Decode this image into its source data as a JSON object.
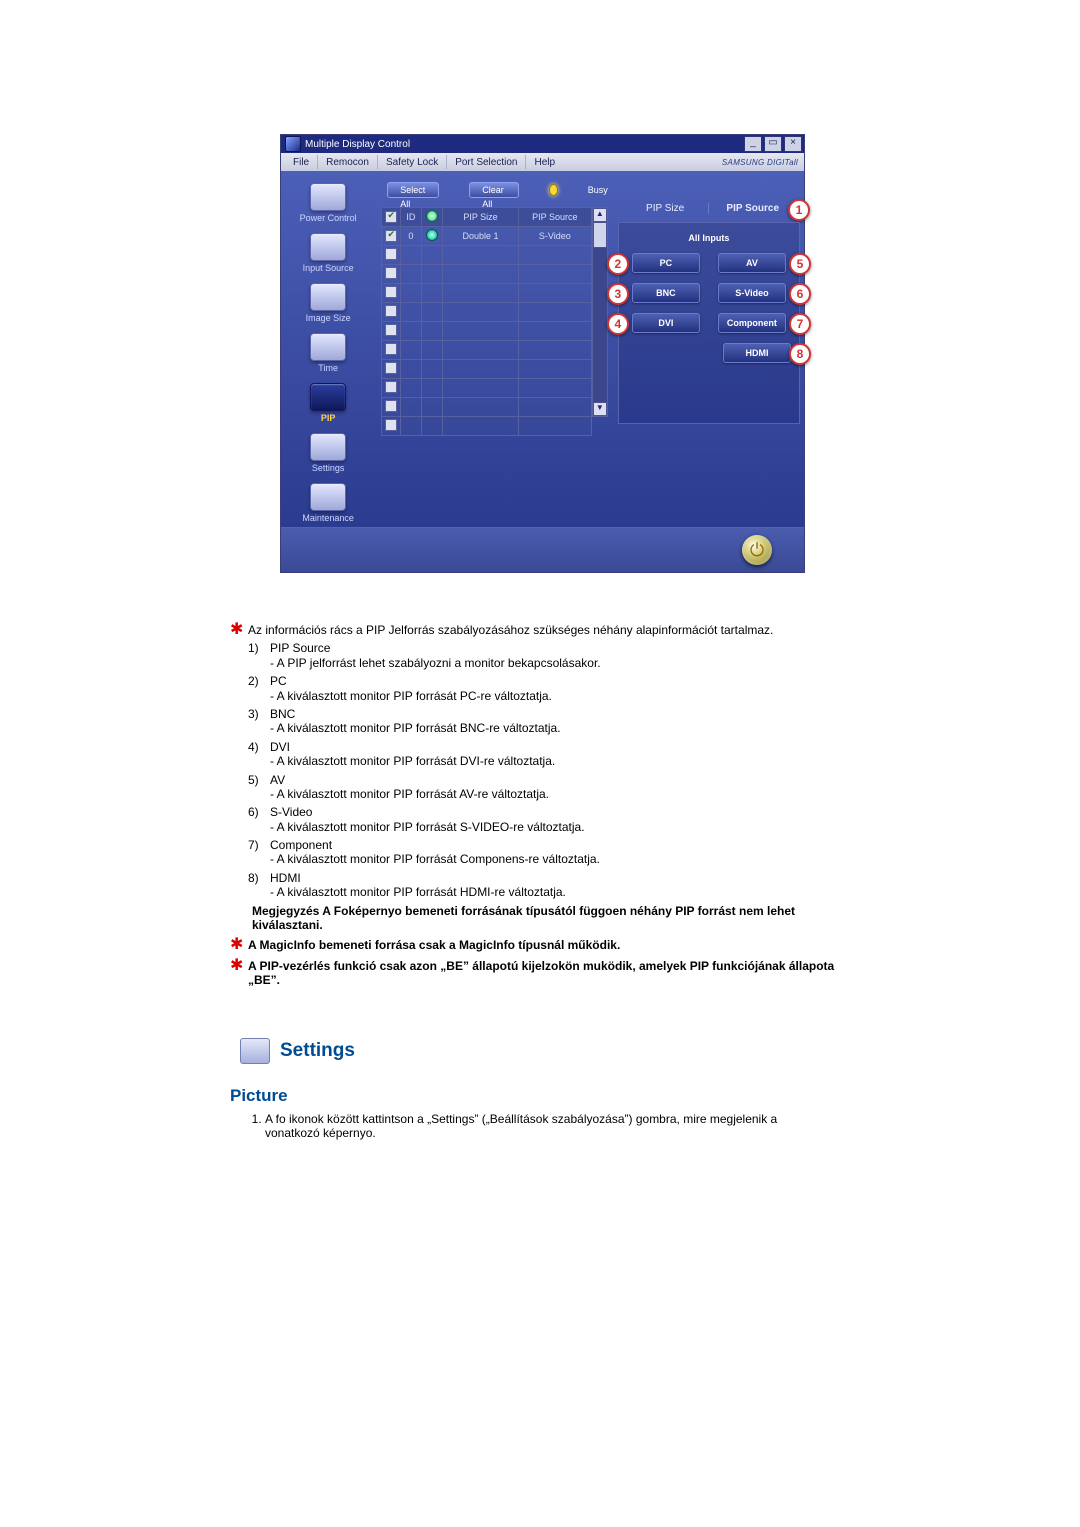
{
  "window": {
    "title": "Multiple Display Control",
    "win_buttons": {
      "min": "_",
      "max": "▭",
      "close": "×"
    }
  },
  "menu": {
    "items": [
      "File",
      "Remocon",
      "Safety Lock",
      "Port Selection",
      "Help"
    ],
    "brand": "SAMSUNG DIGITall"
  },
  "sidebar": [
    {
      "label": "Power Control"
    },
    {
      "label": "Input Source"
    },
    {
      "label": "Image Size"
    },
    {
      "label": "Time"
    },
    {
      "label": "PIP",
      "highlight": true
    },
    {
      "label": "Settings"
    },
    {
      "label": "Maintenance"
    }
  ],
  "topbar": {
    "select_all": "Select All",
    "clear_all": "Clear All",
    "busy": "Busy"
  },
  "grid": {
    "headers": {
      "chk": "",
      "id": "ID",
      "pwr": "",
      "size": "PIP Size",
      "source": "PIP Source"
    },
    "rows": [
      {
        "checked": true,
        "id": "0",
        "pwr": true,
        "status": true,
        "size": "Double 1",
        "source": "S-Video"
      },
      {
        "checked": false
      },
      {
        "checked": false
      },
      {
        "checked": false
      },
      {
        "checked": false
      },
      {
        "checked": false
      },
      {
        "checked": false
      },
      {
        "checked": false
      },
      {
        "checked": false
      },
      {
        "checked": false
      },
      {
        "checked": false
      }
    ]
  },
  "right": {
    "pip_size_label": "PIP Size",
    "pip_source_label": "PIP Source",
    "panel_title": "All Inputs",
    "options": {
      "pc": "PC",
      "av": "AV",
      "bnc": "BNC",
      "svideo": "S-Video",
      "dvi": "DVI",
      "component": "Component",
      "hdmi": "HDMI"
    },
    "callouts": {
      "1": "1",
      "2": "2",
      "3": "3",
      "4": "4",
      "5": "5",
      "6": "6",
      "7": "7",
      "8": "8"
    }
  },
  "doc": {
    "intro": "Az információs rács a PIP Jelforrás szabályozásához szükséges néhány alapinformációt tartalmaz.",
    "items": [
      {
        "n": "1)",
        "title": "PIP Source",
        "desc": "- A PIP jelforrást lehet szabályozni a monitor bekapcsolásakor."
      },
      {
        "n": "2)",
        "title": "PC",
        "desc": "- A kiválasztott monitor PIP forrását PC-re változtatja."
      },
      {
        "n": "3)",
        "title": "BNC",
        "desc": "- A kiválasztott monitor PIP forrását BNC-re változtatja."
      },
      {
        "n": "4)",
        "title": "DVI",
        "desc": "- A kiválasztott monitor PIP forrását DVI-re változtatja."
      },
      {
        "n": "5)",
        "title": "AV",
        "desc": "- A kiválasztott monitor PIP forrását AV-re változtatja."
      },
      {
        "n": "6)",
        "title": "S-Video",
        "desc": "- A kiválasztott monitor PIP forrását S-VIDEO-re változtatja."
      },
      {
        "n": "7)",
        "title": "Component",
        "desc": "- A kiválasztott monitor PIP forrását Componens-re változtatja."
      },
      {
        "n": "8)",
        "title": "HDMI",
        "desc": "- A kiválasztott monitor PIP forrását HDMI-re változtatja."
      }
    ],
    "note": "Megjegyzés A Foképernyo bemeneti forrásának típusától függoen néhány PIP forrást nem lehet kiválasztani.",
    "star2": "A MagicInfo bemeneti forrása csak a MagicInfo típusnál működik.",
    "star3": "A PIP-vezérlés funkció csak azon „BE” állapotú kijelzokön muködik, amelyek PIP funkciójának állapota „BE”.",
    "settings_heading": "Settings",
    "picture_heading": "Picture",
    "picture_step1": "A fo ikonok között kattintson a „Settings” („Beállítások szabályozása”) gombra, mire megjelenik a vonatkozó képernyo."
  }
}
